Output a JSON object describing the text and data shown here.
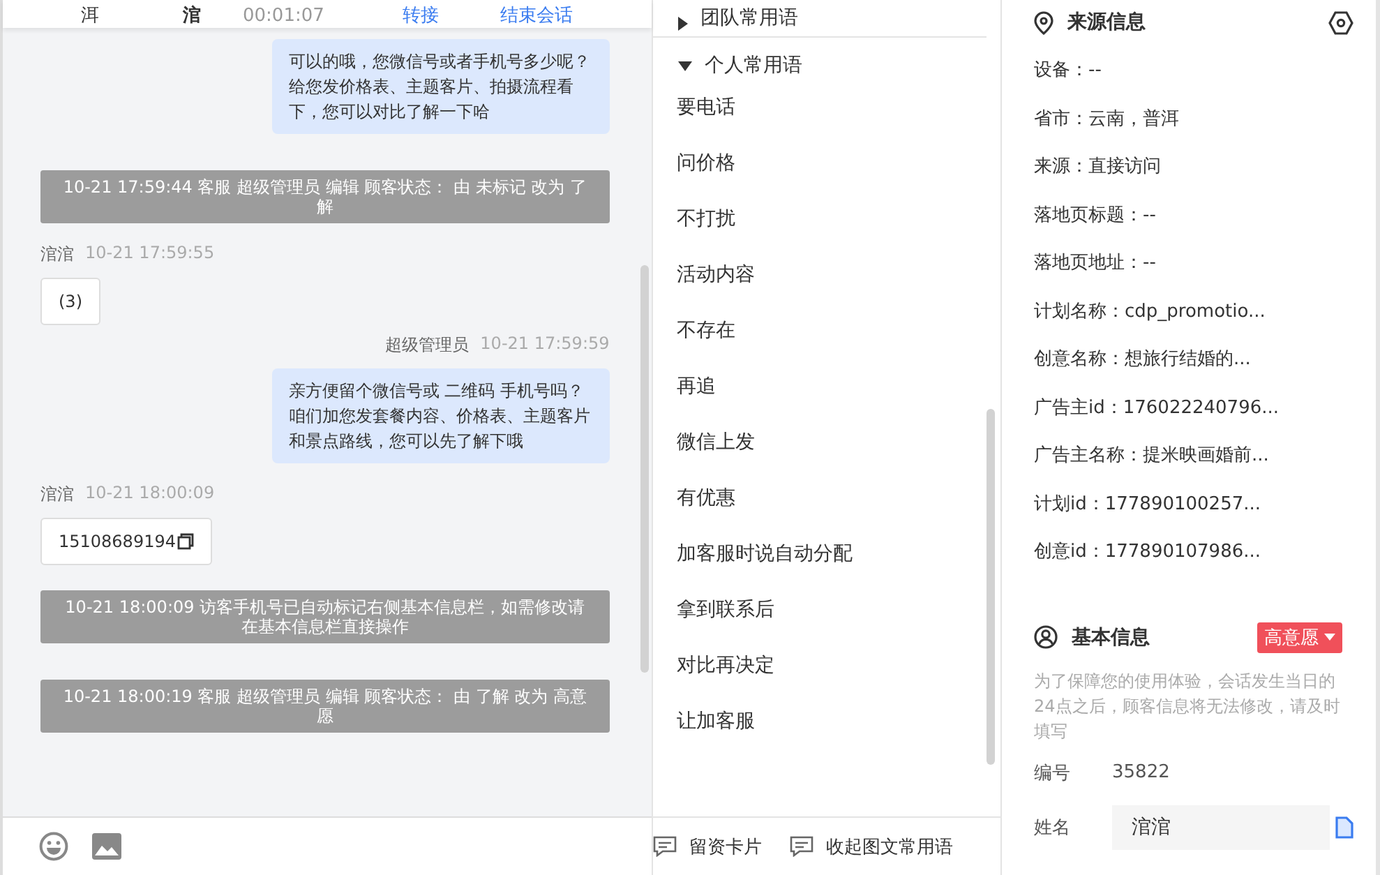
{
  "header": {
    "customer_left": "洱",
    "customer_right": "涫",
    "duration": "00:01:07",
    "actions": [
      "转接",
      "结束会话"
    ]
  },
  "messages": [
    {
      "kind": "agent",
      "text": "可以的哦，您微信号或者手机号多少呢？给您发价格表、主题客片、拍摄流程看下，您可以对比了解一下哈"
    },
    {
      "kind": "system",
      "text": "10-21 17:59:44 客服 超级管理员 编辑 顾客状态： 由 未标记 改为 了解"
    },
    {
      "kind": "visitor",
      "sender": "涫涫",
      "time": "10-21 17:59:55",
      "text": "(3)",
      "copyable": false
    },
    {
      "kind": "agent",
      "sender": "超级管理员",
      "time": "10-21 17:59:59",
      "text": "亲方便留个微信号或 二维码 手机号吗？咱们加您发套餐内容、价格表、主题客片和景点路线，您可以先了解下哦"
    },
    {
      "kind": "visitor",
      "sender": "涫涫",
      "time": "10-21 18:00:09",
      "text": "15108689194",
      "copyable": true
    },
    {
      "kind": "system",
      "text": "10-21 18:00:09 访客手机号已自动标记右侧基本信息栏，如需修改请在基本信息栏直接操作"
    },
    {
      "kind": "system",
      "text": "10-21 18:00:19 客服 超级管理员 编辑 顾客状态： 由 了解 改为 高意愿"
    }
  ],
  "phrase_groups": [
    {
      "title": "团队常用语",
      "expanded": false
    },
    {
      "title": "个人常用语",
      "expanded": true,
      "items": [
        "要电话",
        "问价格",
        "不打扰",
        "活动内容",
        "不存在",
        "再追",
        "微信上发",
        "有优惠",
        "加客服时说自动分配",
        "拿到联系后",
        "对比再决定",
        "让加客服"
      ]
    }
  ],
  "phrase_footer": [
    "留资卡片",
    "收起图文常用语"
  ],
  "source_info": {
    "title": "来源信息",
    "fields": [
      "设备：--",
      "省市：云南，普洱",
      "来源：直接访问",
      "落地页标题：--",
      "落地页地址：--",
      "计划名称：cdp_promotio...",
      "创意名称：想旅行结婚的...",
      "广告主id：176022240796...",
      "广告主名称：提米映画婚前...",
      "计划id：177890100257...",
      "创意id：177890107986..."
    ]
  },
  "basic_info": {
    "title": "基本信息",
    "tag": {
      "label": "高意愿",
      "color": "#f0505a"
    },
    "notice": "为了保障您的使用体验，会话发生当日的24点之后，顾客信息将无法修改，请及时填写",
    "id_label": "编号",
    "id_value": "35822",
    "name_label": "姓名",
    "name_value": "涫涫"
  }
}
